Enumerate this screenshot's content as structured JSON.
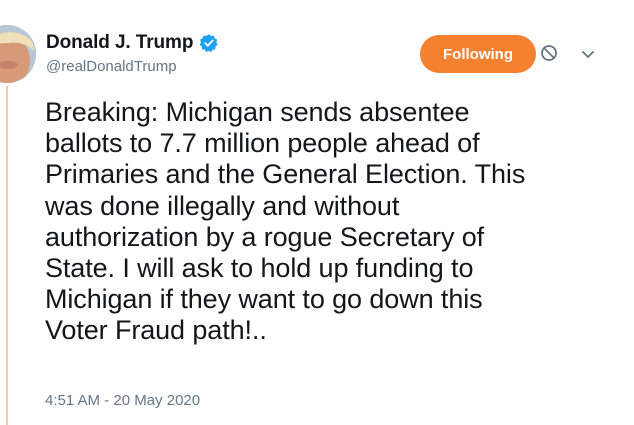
{
  "author": {
    "display_name": "Donald J. Trump",
    "handle": "@realDonaldTrump",
    "verified_icon": "verified-badge-icon",
    "avatar_icon": "profile-photo"
  },
  "actions": {
    "follow_label": "Following",
    "block_icon": "block-icon",
    "menu_icon": "chevron-down-icon"
  },
  "tweet": {
    "lines": [
      "Breaking: Michigan sends absentee",
      "ballots to 7.7 million people ahead of",
      "Primaries and the General Election. This",
      "was done illegally and without",
      "authorization by a rogue Secretary of",
      "State. I will ask to hold up funding to",
      "Michigan if they want to go down this",
      "Voter Fraud path!.."
    ],
    "timestamp": "4:51 AM - 20 May 2020"
  },
  "colors": {
    "accent": "#f4812f",
    "verified": "#1da1f2",
    "secondary_text": "#657786",
    "primary_text": "#14171a"
  }
}
